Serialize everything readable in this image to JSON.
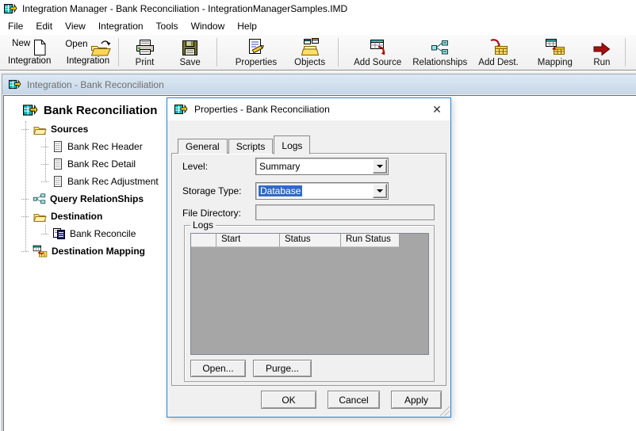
{
  "window_title": "Integration Manager - Bank Reconciliation - IntegrationManagerSamples.IMD",
  "menu": {
    "items": [
      "File",
      "Edit",
      "View",
      "Integration",
      "Tools",
      "Window",
      "Help"
    ]
  },
  "toolbar": {
    "buttons": [
      {
        "line1": "New",
        "line2": "Integration",
        "icon": "new-integration-icon"
      },
      {
        "line1": "Open",
        "line2": "Integration",
        "icon": "open-integration-icon"
      },
      {
        "label": "Print",
        "icon": "print-icon"
      },
      {
        "label": "Save",
        "icon": "save-icon"
      },
      {
        "label": "Properties",
        "icon": "properties-icon"
      },
      {
        "label": "Objects",
        "icon": "objects-icon"
      },
      {
        "label": "Add Source",
        "icon": "add-source-icon"
      },
      {
        "label": "Relationships",
        "icon": "relationships-icon"
      },
      {
        "label": "Add Dest.",
        "icon": "add-dest-icon"
      },
      {
        "label": "Mapping",
        "icon": "mapping-icon"
      },
      {
        "label": "Run",
        "icon": "run-icon"
      }
    ]
  },
  "document_window": {
    "title": "Integration - Bank Reconciliation",
    "tree": {
      "root": "Bank Reconciliation",
      "items": [
        {
          "label": "Sources",
          "level": 1,
          "bold": true,
          "icon": "folder-icon"
        },
        {
          "label": "Bank Rec Header",
          "level": 2,
          "icon": "document-icon"
        },
        {
          "label": "Bank Rec Detail",
          "level": 2,
          "icon": "document-icon"
        },
        {
          "label": "Bank Rec Adjustment",
          "level": 2,
          "icon": "document-icon"
        },
        {
          "label": "Query RelationShips",
          "level": 1,
          "bold": true,
          "icon": "relationships-icon"
        },
        {
          "label": "Destination",
          "level": 1,
          "bold": true,
          "icon": "folder-icon"
        },
        {
          "label": "Bank Reconcile",
          "level": 2,
          "icon": "tables-icon"
        },
        {
          "label": "Destination Mapping",
          "level": 1,
          "bold": true,
          "icon": "mapping-icon"
        }
      ]
    }
  },
  "dialog": {
    "title": "Properties - Bank Reconciliation",
    "tabs": [
      "General",
      "Scripts",
      "Logs"
    ],
    "active_tab": "Logs",
    "fields": {
      "level": {
        "label": "Level:",
        "value": "Summary"
      },
      "storage_type": {
        "label": "Storage Type:",
        "value": "Database",
        "selected": true
      },
      "file_directory": {
        "label": "File Directory:",
        "value": "",
        "disabled": true
      }
    },
    "logs_group": {
      "title": "Logs",
      "columns": [
        "",
        "Start",
        "Status",
        "Run Status"
      ],
      "rows": [],
      "buttons": {
        "open": "Open...",
        "purge": "Purge..."
      }
    },
    "footer_buttons": {
      "ok": "OK",
      "cancel": "Cancel",
      "apply": "Apply"
    }
  },
  "icons": {
    "close": "✕"
  },
  "icon_names": [
    "app-icon",
    "new-integration-icon",
    "open-integration-icon",
    "print-icon",
    "save-icon",
    "properties-icon",
    "objects-icon",
    "add-source-icon",
    "relationships-icon",
    "add-dest-icon",
    "mapping-icon",
    "run-icon",
    "folder-icon",
    "document-icon",
    "tables-icon",
    "close-icon"
  ],
  "colors": {
    "selection": "#316ac5",
    "dialog_border": "#2585d8",
    "mdi_titlebar_top": "#dde9f4",
    "mdi_titlebar_bottom": "#c7d7e7",
    "table_body": "#a6a6a6",
    "run_arrow": "#a51212"
  }
}
